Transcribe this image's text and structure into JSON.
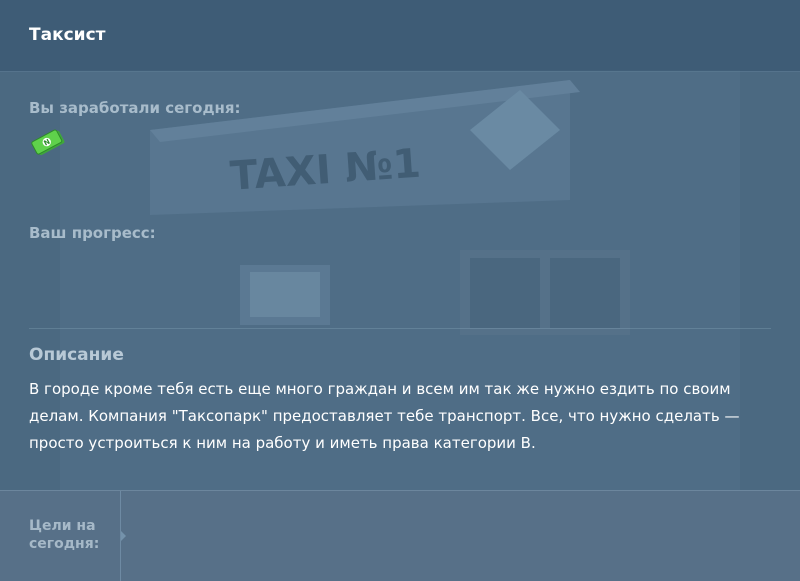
{
  "header": {
    "title": "Таксист"
  },
  "earnings": {
    "label": "Вы заработали сегодня:",
    "icon": "money-icon"
  },
  "progress": {
    "label": "Ваш прогресс:"
  },
  "description": {
    "title": "Описание",
    "text": "В городе кроме тебя есть еще много граждан и всем им так же нужно ездить по своим делам. Компания \"Таксопарк\" предоставляет тебе транспорт. Все, что нужно сделать — просто устроиться к ним на работу и иметь права категории В."
  },
  "goals": {
    "label": "Цели на сегодня:"
  },
  "background": {
    "sign_text": "TAXI №1"
  }
}
